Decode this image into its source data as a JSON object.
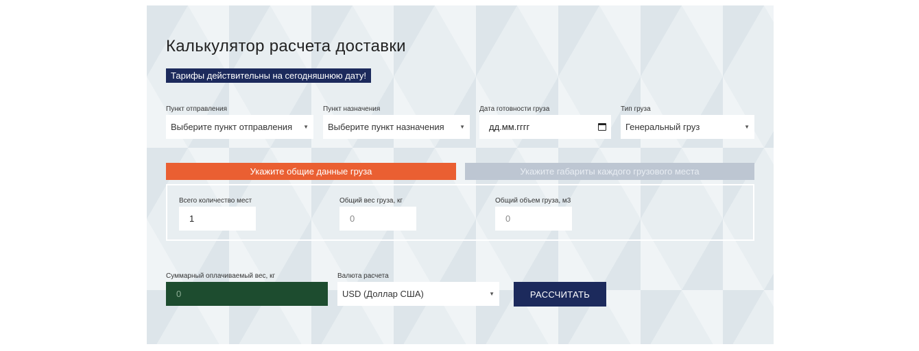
{
  "title": "Калькулятор расчета доставки",
  "notice": "Тарифы действительны на сегодняшнюю дату!",
  "route": {
    "origin": {
      "label": "Пункт отправления",
      "value": "Выберите пункт отправления"
    },
    "destination": {
      "label": "Пункт назначения",
      "value": "Выберите пункт назначения"
    },
    "date": {
      "label": "Дата готовности груза",
      "value": "дд.мм.гггг"
    },
    "cargo_type": {
      "label": "Тип груза",
      "value": "Генеральный груз"
    }
  },
  "tabs": {
    "general": "Укажите общие данные груза",
    "dimensions": "Укажите габариты каждого грузового места"
  },
  "cargo": {
    "places": {
      "label": "Всего количество мест",
      "value": "1"
    },
    "weight": {
      "label": "Общий вес груза, кг",
      "value": "0"
    },
    "volume": {
      "label": "Общий объем груза, м3",
      "value": "0"
    }
  },
  "summary": {
    "billable_weight": {
      "label": "Суммарный оплачиваемый вес, кг",
      "value": "0"
    },
    "currency": {
      "label": "Валюта расчета",
      "value": "USD (Доллар США)"
    },
    "calculate_label": "РАССЧИТАТЬ"
  },
  "colors": {
    "accent_orange": "#ea5f32",
    "navy": "#1c2a5c",
    "dark_green": "#1d4c2f",
    "tab_inactive": "#bdc6d2"
  }
}
